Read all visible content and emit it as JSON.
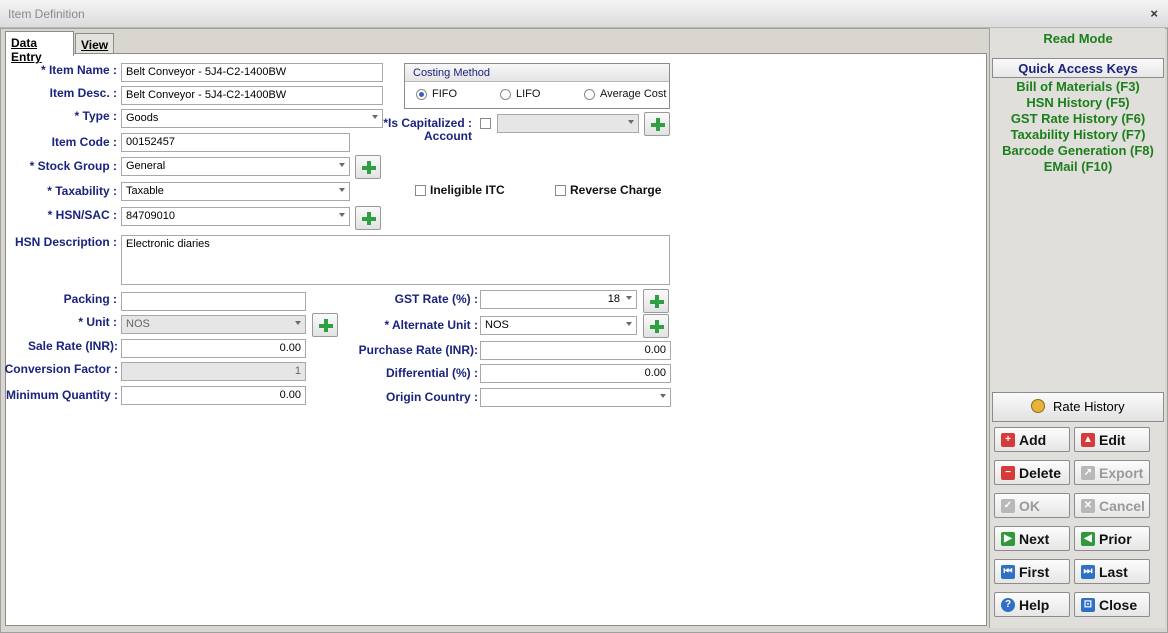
{
  "window": {
    "title": "Item Definition",
    "close_glyph": "×"
  },
  "tabs": [
    {
      "label": "Data Entry"
    },
    {
      "label": "View"
    }
  ],
  "costing": {
    "title": "Costing Method",
    "options": [
      {
        "label": "FIFO",
        "selected": true
      },
      {
        "label": "LIFO",
        "selected": false
      },
      {
        "label": "Average Cost",
        "selected": false
      }
    ]
  },
  "form": {
    "item_name_label": "* Item Name :",
    "item_name": "Belt Conveyor - 5J4-C2-1400BW",
    "item_desc_label": "Item Desc. :",
    "item_desc": "Belt Conveyor - 5J4-C2-1400BW",
    "type_label": "* Type :",
    "type": "Goods",
    "item_code_label": "Item Code :",
    "item_code": "00152457",
    "stock_group_label": "* Stock Group :",
    "stock_group": "General",
    "taxability_label": "* Taxability :",
    "taxability": "Taxable",
    "hsn_label": "* HSN/SAC :",
    "hsn": "84709010",
    "hsn_desc_label": "HSN Description :",
    "hsn_desc": "Electronic diaries",
    "is_capitalized_label_1": "*Is Capitalized :",
    "is_capitalized_label_2": "Account",
    "ineligible_itc_label": "Ineligible ITC",
    "reverse_charge_label": "Reverse Charge",
    "packing_label": "Packing :",
    "packing": "",
    "unit_label": "* Unit :",
    "unit": "NOS",
    "sale_rate_label": "Sale Rate (INR):",
    "sale_rate": "0.00",
    "conversion_label": "Conversion Factor :",
    "conversion": "1",
    "min_qty_label": "Minimum Quantity :",
    "min_qty": "0.00",
    "gst_rate_label": "GST Rate (%) :",
    "gst_rate": "18",
    "alt_unit_label": "* Alternate Unit :",
    "alt_unit": "NOS",
    "purchase_rate_label": "Purchase Rate (INR):",
    "purchase_rate": "0.00",
    "differential_label": "Differential (%) :",
    "differential": "0.00",
    "origin_label": "Origin Country :",
    "origin": ""
  },
  "sidebar": {
    "mode": "Read Mode",
    "quick_access_title": "Quick Access Keys",
    "quick_keys": [
      "Bill of Materials (F3)",
      "HSN History (F5)",
      "GST Rate History (F6)",
      "Taxability History (F7)",
      "Barcode Generation (F8)",
      "EMail (F10)"
    ],
    "rate_history": "Rate History"
  },
  "buttons": {
    "add": "Add",
    "edit": "Edit",
    "delete": "Delete",
    "export": "Export",
    "ok": "OK",
    "cancel": "Cancel",
    "next": "Next",
    "prior": "Prior",
    "first": "First",
    "last": "Last",
    "help": "Help",
    "close": "Close"
  },
  "colors": {
    "label": "#1a237e",
    "accent_green": "#1b7f1b",
    "plus_green": "#2ea043"
  }
}
